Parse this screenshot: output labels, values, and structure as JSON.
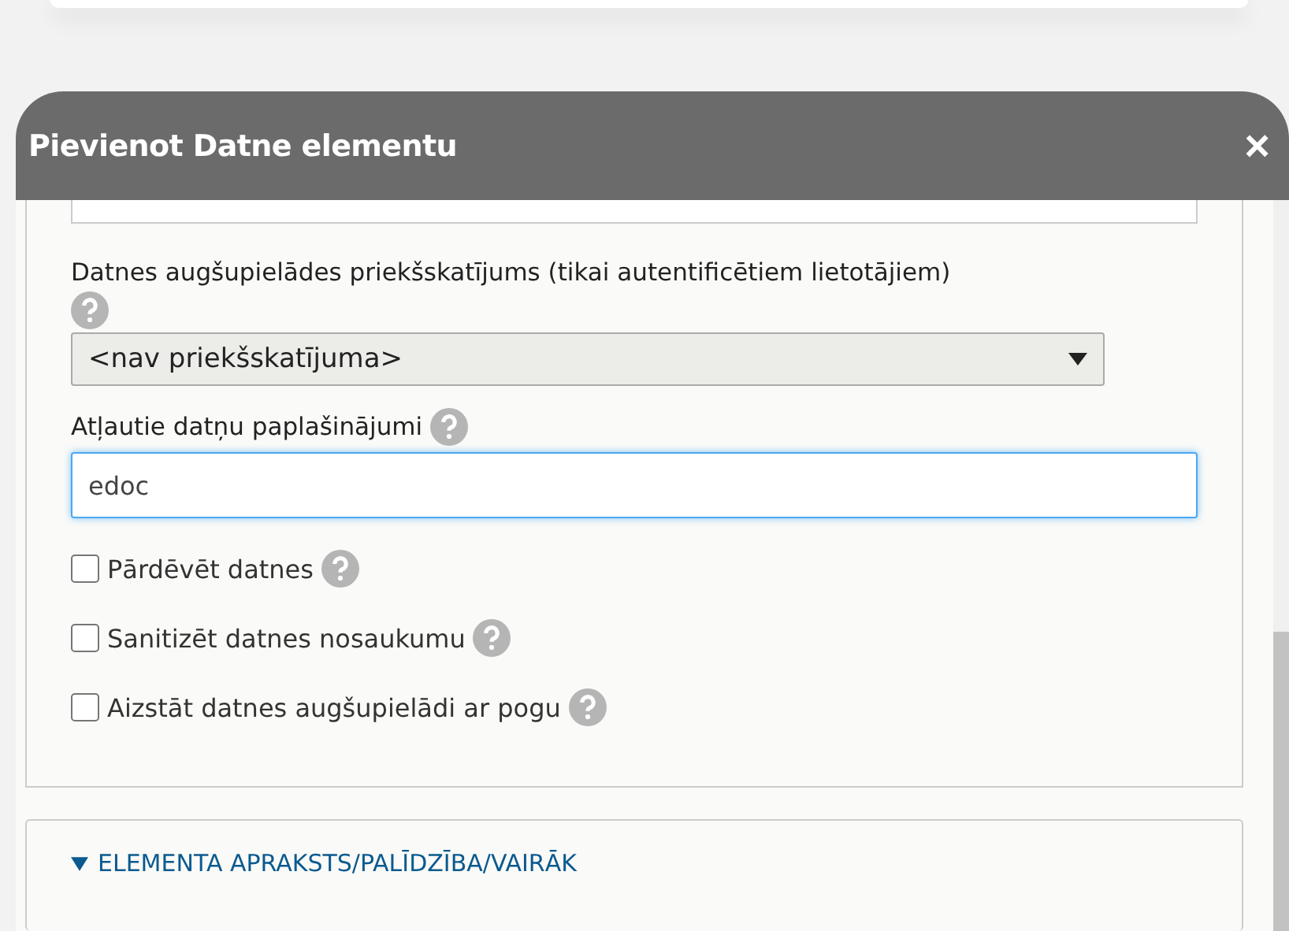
{
  "dialog": {
    "title": "Pievienot Datne elementu",
    "close": "×"
  },
  "preview": {
    "label": "Datnes augšupielādes priekšskatījums (tikai autentificētiem lietotājiem)",
    "value": "<nav priekšskatījuma>"
  },
  "extensions": {
    "label": "Atļautie datņu paplašinājumi",
    "value": "edoc"
  },
  "options": [
    {
      "label": "Pārdēvēt datnes",
      "checked": false
    },
    {
      "label": "Sanitizēt datnes nosaukumu",
      "checked": false
    },
    {
      "label": "Aizstāt datnes augšupielādi ar pogu",
      "checked": false
    }
  ],
  "details": {
    "label": "ELEMENTA APRAKSTS/PALĪDZĪBA/VAIRĀK",
    "expanded": true
  }
}
